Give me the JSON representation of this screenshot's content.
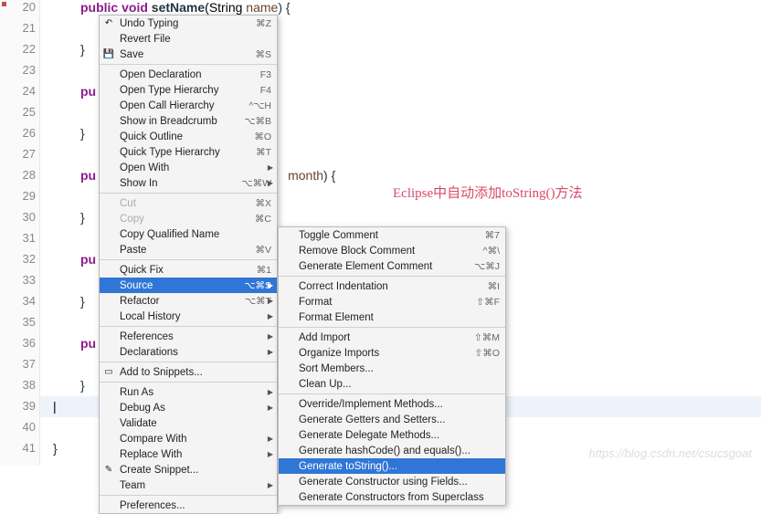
{
  "gutter": {
    "lines": [
      "20",
      "21",
      "22",
      "23",
      "24",
      "25",
      "26",
      "27",
      "28",
      "29",
      "30",
      "31",
      "32",
      "33",
      "34",
      "35",
      "36",
      "37",
      "38",
      "39",
      "40",
      "41"
    ]
  },
  "code": {
    "l20": {
      "kw1": "public ",
      "kw2": "void ",
      "name": "setName",
      "args": "(String ",
      "param": "name",
      "tail": ") {"
    },
    "l22": "}",
    "l24": {
      "kw": "pu"
    },
    "l26": "}",
    "l28": {
      "kw": "pu",
      "mid": "month",
      "tail": ") {"
    },
    "l30": "}",
    "l32": {
      "kw": "pu"
    },
    "l34": "}",
    "l36": {
      "kw": "pu"
    },
    "l38": "}",
    "l41": "}"
  },
  "menu1": [
    {
      "icon": "↶",
      "label": "Undo Typing",
      "shortcut": "⌘Z"
    },
    {
      "label": "Revert File"
    },
    {
      "icon": "💾",
      "label": "Save",
      "shortcut": "⌘S"
    },
    {
      "sep": true
    },
    {
      "label": "Open Declaration",
      "shortcut": "F3"
    },
    {
      "label": "Open Type Hierarchy",
      "shortcut": "F4"
    },
    {
      "label": "Open Call Hierarchy",
      "shortcut": "^⌥H"
    },
    {
      "label": "Show in Breadcrumb",
      "shortcut": "⌥⌘B"
    },
    {
      "label": "Quick Outline",
      "shortcut": "⌘O"
    },
    {
      "label": "Quick Type Hierarchy",
      "shortcut": "⌘T"
    },
    {
      "label": "Open With",
      "sub": true
    },
    {
      "label": "Show In",
      "shortcut": "⌥⌘W",
      "sub": true
    },
    {
      "sep": true
    },
    {
      "label": "Cut",
      "shortcut": "⌘X",
      "dim": true
    },
    {
      "label": "Copy",
      "shortcut": "⌘C",
      "dim": true
    },
    {
      "label": "Copy Qualified Name"
    },
    {
      "label": "Paste",
      "shortcut": "⌘V"
    },
    {
      "sep": true
    },
    {
      "label": "Quick Fix",
      "shortcut": "⌘1"
    },
    {
      "label": "Source",
      "shortcut": "⌥⌘S",
      "sub": true,
      "hl": true
    },
    {
      "label": "Refactor",
      "shortcut": "⌥⌘T",
      "sub": true
    },
    {
      "label": "Local History",
      "sub": true
    },
    {
      "sep": true
    },
    {
      "label": "References",
      "sub": true
    },
    {
      "label": "Declarations",
      "sub": true
    },
    {
      "sep": true
    },
    {
      "icon": "▭",
      "label": "Add to Snippets..."
    },
    {
      "sep": true
    },
    {
      "label": "Run As",
      "sub": true
    },
    {
      "label": "Debug As",
      "sub": true
    },
    {
      "label": "Validate"
    },
    {
      "label": "Compare With",
      "sub": true
    },
    {
      "label": "Replace With",
      "sub": true
    },
    {
      "icon": "✎",
      "label": "Create Snippet..."
    },
    {
      "label": "Team",
      "sub": true
    },
    {
      "sep": true
    },
    {
      "label": "Preferences..."
    }
  ],
  "menu2": [
    {
      "label": "Toggle Comment",
      "shortcut": "⌘7"
    },
    {
      "label": "Remove Block Comment",
      "shortcut": "^⌘\\"
    },
    {
      "label": "Generate Element Comment",
      "shortcut": "⌥⌘J"
    },
    {
      "sep": true
    },
    {
      "label": "Correct Indentation",
      "shortcut": "⌘I"
    },
    {
      "label": "Format",
      "shortcut": "⇧⌘F"
    },
    {
      "label": "Format Element"
    },
    {
      "sep": true
    },
    {
      "label": "Add Import",
      "shortcut": "⇧⌘M"
    },
    {
      "label": "Organize Imports",
      "shortcut": "⇧⌘O"
    },
    {
      "label": "Sort Members..."
    },
    {
      "label": "Clean Up..."
    },
    {
      "sep": true
    },
    {
      "label": "Override/Implement Methods..."
    },
    {
      "label": "Generate Getters and Setters..."
    },
    {
      "label": "Generate Delegate Methods..."
    },
    {
      "label": "Generate hashCode() and equals()..."
    },
    {
      "label": "Generate toString()...",
      "hl": true
    },
    {
      "label": "Generate Constructor using Fields..."
    },
    {
      "label": "Generate Constructors from Superclass"
    }
  ],
  "annotation": "Eclipse中自动添加toString()方法",
  "watermark": "https://blog.csdn.net/csucsgoat"
}
